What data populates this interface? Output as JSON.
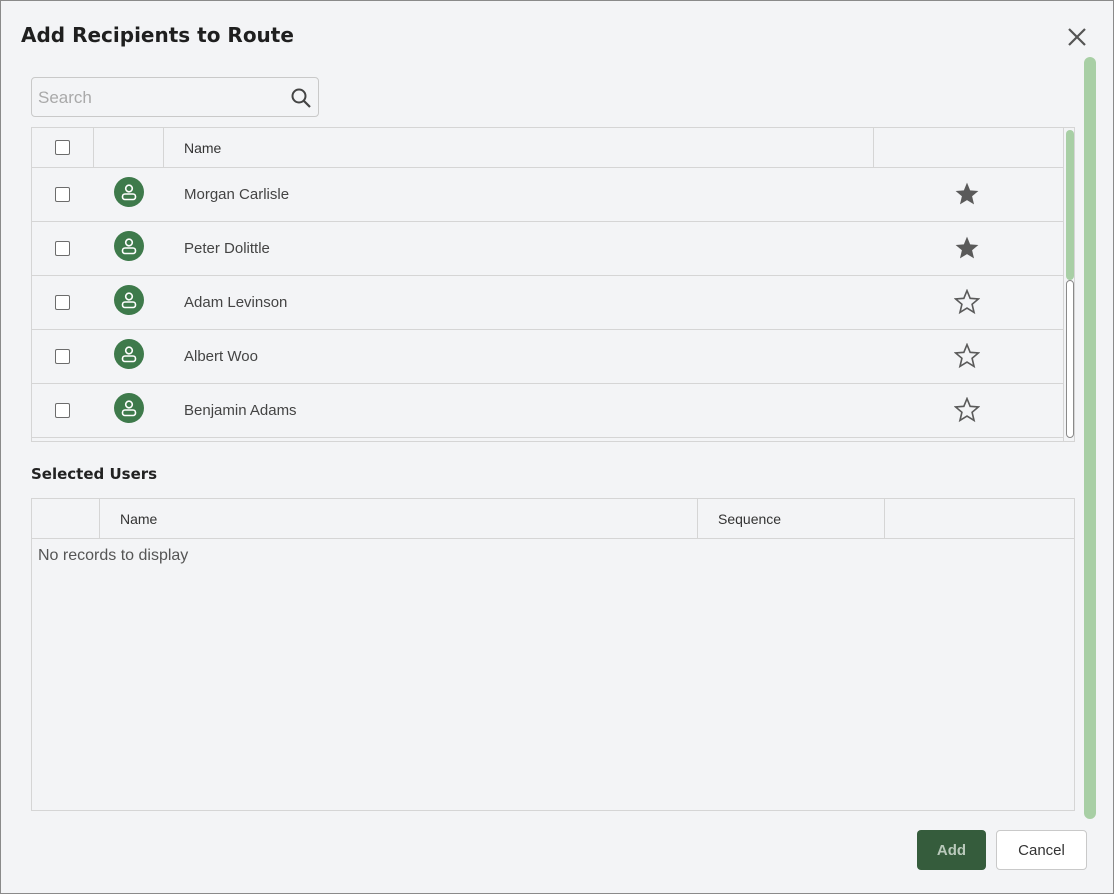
{
  "dialog": {
    "title": "Add Recipients to Route",
    "close_icon": "close-icon"
  },
  "search": {
    "placeholder": "Search",
    "value": "",
    "icon": "search-icon"
  },
  "recipients_grid": {
    "columns": [
      "",
      "",
      "Name",
      ""
    ],
    "rows": [
      {
        "name": "Morgan Carlisle",
        "favorite": true,
        "checked": false
      },
      {
        "name": "Peter Dolittle",
        "favorite": true,
        "checked": false
      },
      {
        "name": "Adam Levinson",
        "favorite": false,
        "checked": false
      },
      {
        "name": "Albert Woo",
        "favorite": false,
        "checked": false
      },
      {
        "name": "Benjamin Adams",
        "favorite": false,
        "checked": false
      }
    ]
  },
  "selected_users": {
    "title": "Selected Users",
    "columns": [
      "",
      "Name",
      "Sequence",
      ""
    ],
    "empty_message": "No records to display"
  },
  "footer": {
    "add_label": "Add",
    "cancel_label": "Cancel"
  },
  "colors": {
    "accent": "#3e7a4b",
    "primary_button": "#355c3c",
    "scrollbar": "#a8cfa5",
    "background": "#f3f4f6"
  }
}
